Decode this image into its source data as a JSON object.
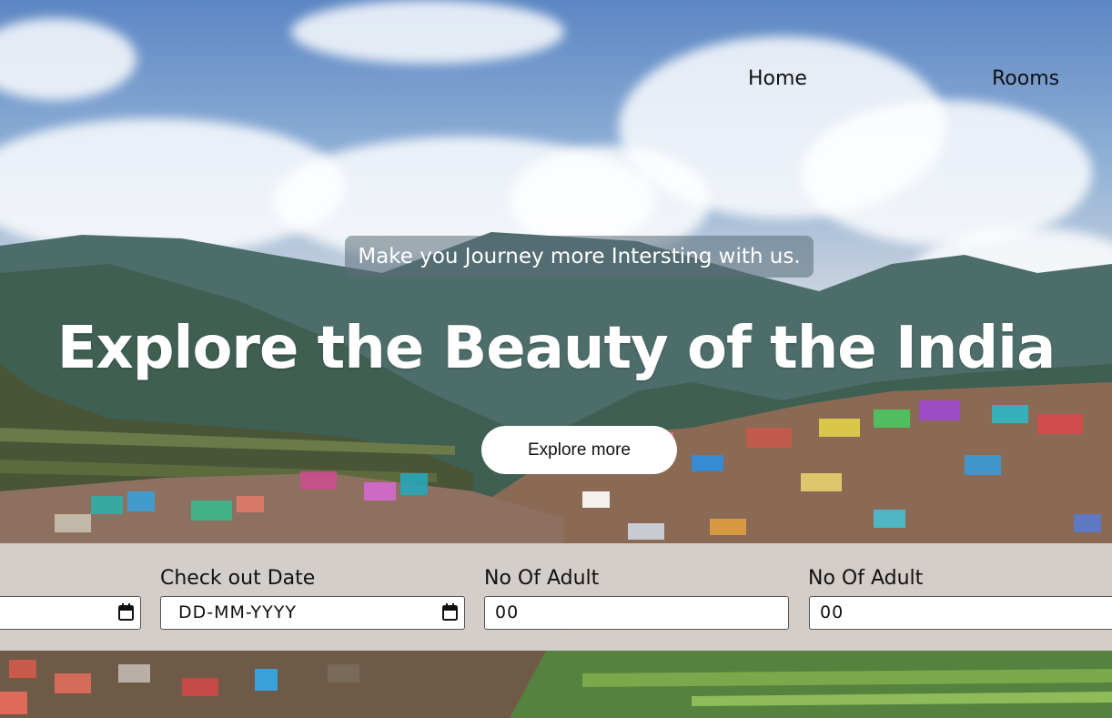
{
  "nav": {
    "home_label": "Home",
    "rooms_label": "Rooms"
  },
  "hero": {
    "tagline": "Make you Journey more Intersting with us.",
    "headline": "Explore the Beauty of the India",
    "button_label": "Explore more"
  },
  "booking": {
    "fields": [
      {
        "label": "",
        "type": "date",
        "value": ""
      },
      {
        "label": "Check out Date",
        "type": "date",
        "value": "DD-MM-YYYY"
      },
      {
        "label": "No Of Adult",
        "type": "number",
        "value": "00"
      },
      {
        "label": "No Of Adult",
        "type": "number",
        "value": "00"
      }
    ]
  },
  "icons": {
    "calendar": "calendar-icon"
  }
}
